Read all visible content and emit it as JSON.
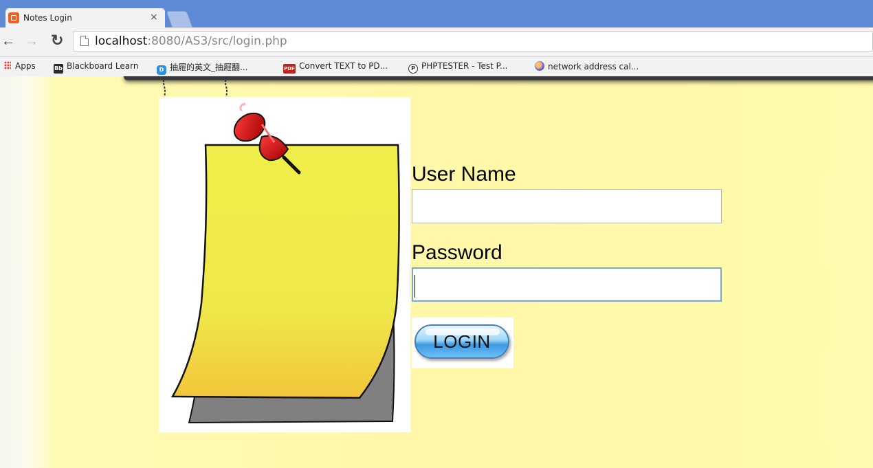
{
  "browser": {
    "tab_title": "Notes Login",
    "tab_close": "×",
    "url_host": "localhost",
    "url_path": ":8080/AS3/src/login.php"
  },
  "bookmarks": [
    {
      "label": "Apps",
      "icon": "apps-grid-icon"
    },
    {
      "label": "Blackboard Learn",
      "icon": "blackboard-icon",
      "icon_text": "Bb",
      "color": "#2b2b2b"
    },
    {
      "label": "抽屜的英文_抽屜翻...",
      "icon": "dictionary-icon",
      "icon_text": "D",
      "color": "#2d8fe0"
    },
    {
      "label": "Convert TEXT to PD...",
      "icon": "pdf-icon",
      "icon_text": "PDF",
      "color": "#c0251d"
    },
    {
      "label": "PHPTESTER - Test P...",
      "icon": "phptester-icon",
      "icon_text": "P",
      "color": "#333333"
    },
    {
      "label": "network address cal...",
      "icon": "network-icon",
      "icon_text": "",
      "color": "#6a5acd"
    }
  ],
  "form": {
    "username_label": "User Name",
    "username_value": "",
    "password_label": "Password",
    "password_value": "",
    "login_label": "LOGIN"
  },
  "colors": {
    "page_background": "#fff8a8",
    "note": "#f0ee4a",
    "pin": "#cc0000"
  }
}
